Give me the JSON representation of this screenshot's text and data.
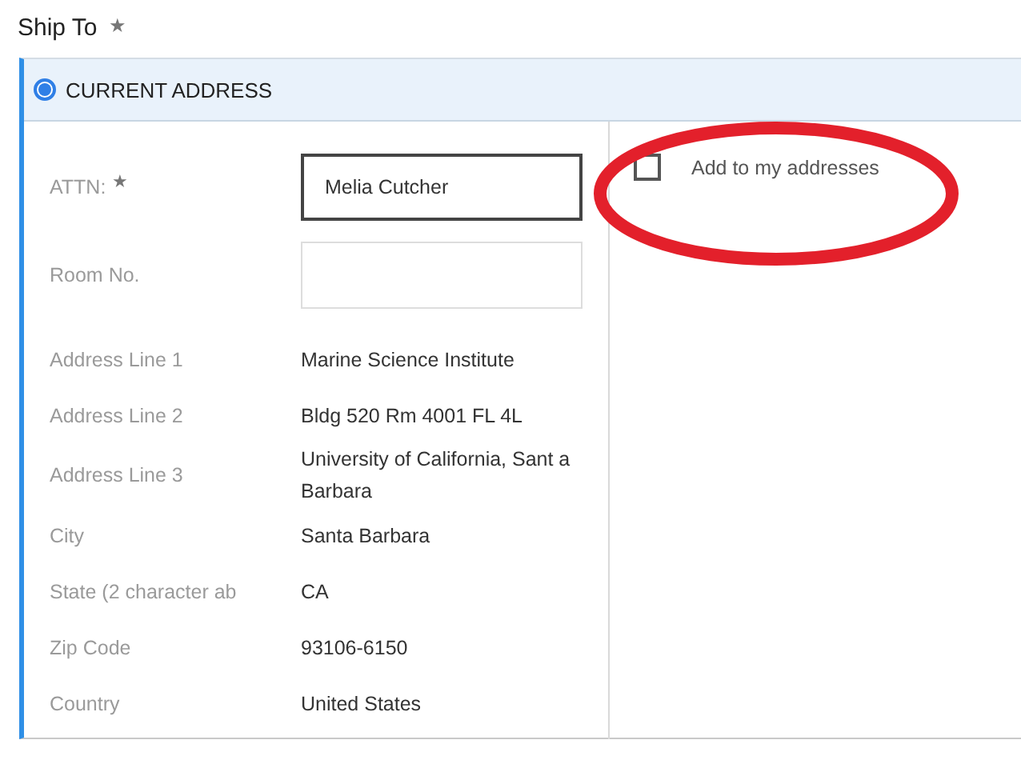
{
  "section": {
    "title": "Ship To",
    "required_mark": "★"
  },
  "address_option": {
    "label": "CURRENT ADDRESS",
    "selected": true
  },
  "fields": [
    {
      "label": "ATTN:",
      "required_mark": "★",
      "kind": "input",
      "value": "Melia Cutcher"
    },
    {
      "label": "Room No.",
      "kind": "input"
    },
    {
      "label": "Address Line 1",
      "kind": "text",
      "value": "Marine Science Institute"
    },
    {
      "label": "Address Line 2",
      "kind": "text",
      "value": "Bldg 520 Rm 4001 FL 4L"
    },
    {
      "label": "Address Line 3",
      "kind": "text",
      "value": "University of California, Sant a Barbara"
    },
    {
      "label": "City",
      "kind": "text",
      "value": "Santa Barbara"
    },
    {
      "label": "State (2 character ab",
      "kind": "text",
      "value": "CA"
    },
    {
      "label": "Zip Code",
      "kind": "text",
      "value": "93106-6150"
    },
    {
      "label": "Country",
      "kind": "text",
      "value": "United States"
    }
  ],
  "save_option": {
    "label": "Add to my addresses",
    "checked": false
  },
  "annotation": {
    "kind": "ellipse",
    "color": "#e3202b"
  }
}
